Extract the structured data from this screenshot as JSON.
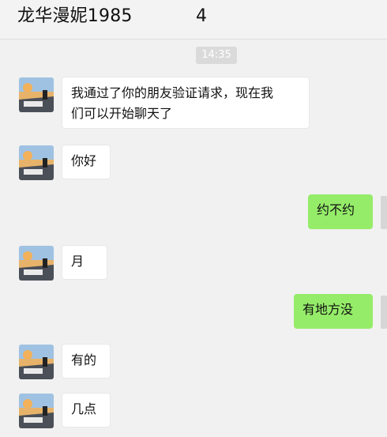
{
  "header": {
    "title": "龙华漫妮1985",
    "title_tail": "4"
  },
  "timestamp": "14:35",
  "messages": [
    {
      "side": "in",
      "text": "我通过了你的朋友验证请求，现在我们可以开始聊天了",
      "line1": "我通过了你的朋友验证请求，现在我",
      "line2": "们可以开始聊天了"
    },
    {
      "side": "in",
      "text": "你好"
    },
    {
      "side": "out",
      "text": "约不约"
    },
    {
      "side": "in",
      "text": "月"
    },
    {
      "side": "out",
      "text": "有地方没"
    },
    {
      "side": "in",
      "text": "有的"
    },
    {
      "side": "in",
      "text": "几点"
    }
  ],
  "colors": {
    "outgoing_bubble": "#95ec69",
    "incoming_bubble": "#ffffff",
    "background": "#f1f1f1",
    "timestamp_badge": "#dadada"
  }
}
